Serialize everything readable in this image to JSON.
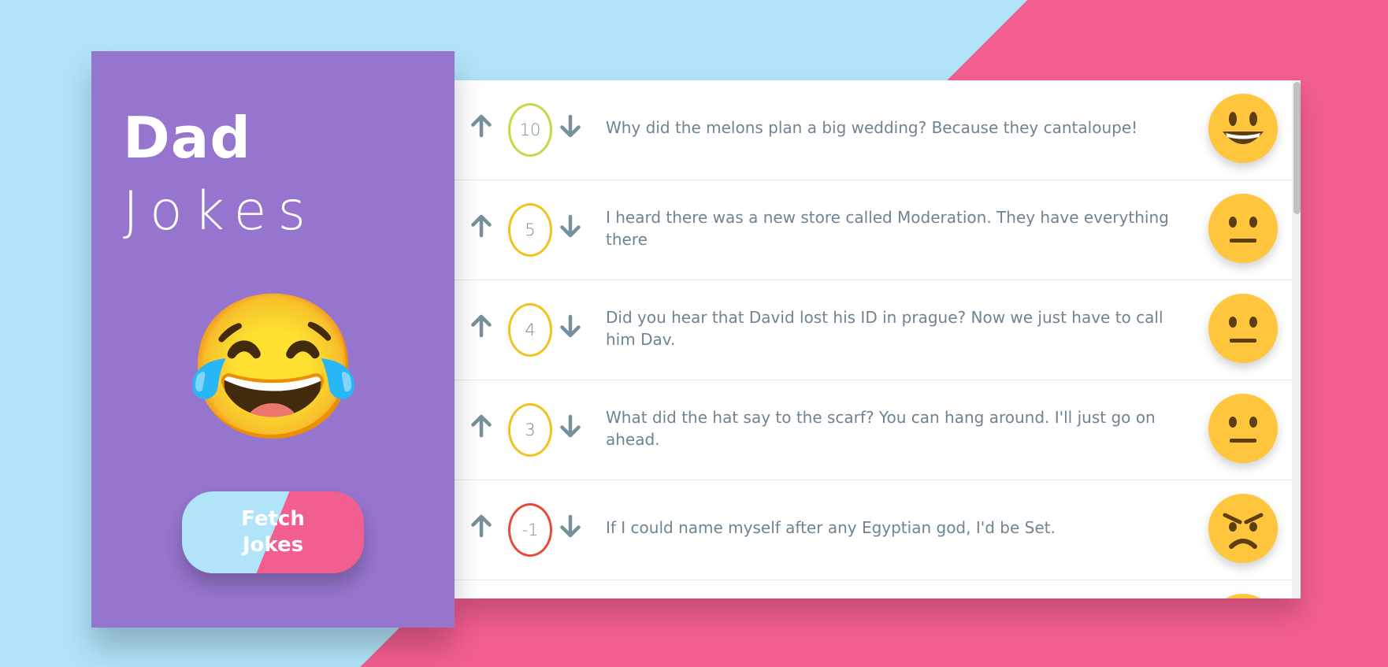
{
  "sidebar": {
    "title_bold": "Dad",
    "title_light": "Jokes",
    "emoji": "😂",
    "emoji_name": "face-with-tears-of-joy-icon",
    "fetch_button": "Fetch Jokes"
  },
  "jokes": [
    {
      "votes": "10",
      "text": "Why did the melons plan a big wedding? Because they cantaloupe!",
      "face": "grin",
      "border_color": "#c0dc42"
    },
    {
      "votes": "5",
      "text": "I heard there was a new store called Moderation. They have everything there",
      "face": "neutral",
      "border_color": "#f1c31c"
    },
    {
      "votes": "4",
      "text": "Did you hear that David lost his ID in prague? Now we just have to call him Dav.",
      "face": "neutral",
      "border_color": "#f1c31c"
    },
    {
      "votes": "3",
      "text": "What did the hat say to the scarf? You can hang around. I'll just go on ahead.",
      "face": "neutral",
      "border_color": "#f1c31c"
    },
    {
      "votes": "-1",
      "text": "If I could name myself after any Egyptian god, I'd be Set.",
      "face": "angry",
      "border_color": "#e84a3a"
    }
  ],
  "colors": {
    "background_blue": "#b1e4f9",
    "background_pink": "#f25e8f",
    "sidebar_purple": "#9575cd",
    "arrow_gray": "#78909c",
    "text_gray": "#6f8391",
    "emoji_yellow": "#ffc53d"
  }
}
